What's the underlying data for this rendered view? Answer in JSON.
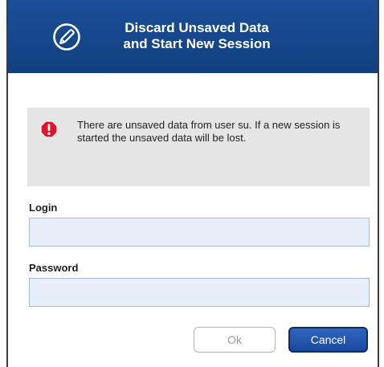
{
  "dialog": {
    "title_line1": "Discard Unsaved Data",
    "title_line2": "and Start New Session",
    "header_icon": "pencil-circle-icon",
    "warning": {
      "icon": "alert-octagon-icon",
      "text": "There are unsaved data from user su. If a new session is started the unsaved data will be lost."
    },
    "login": {
      "label": "Login",
      "value": "",
      "placeholder": ""
    },
    "password": {
      "label": "Password",
      "value": "",
      "placeholder": ""
    },
    "buttons": {
      "ok_label": "Ok",
      "cancel_label": "Cancel"
    }
  },
  "colors": {
    "header_bg": "#1c4f9a",
    "warning_bg": "#e5e5e5",
    "alert_red": "#e0122f",
    "input_bg": "#e6eefa",
    "cancel_bg": "#1a4a9c"
  }
}
